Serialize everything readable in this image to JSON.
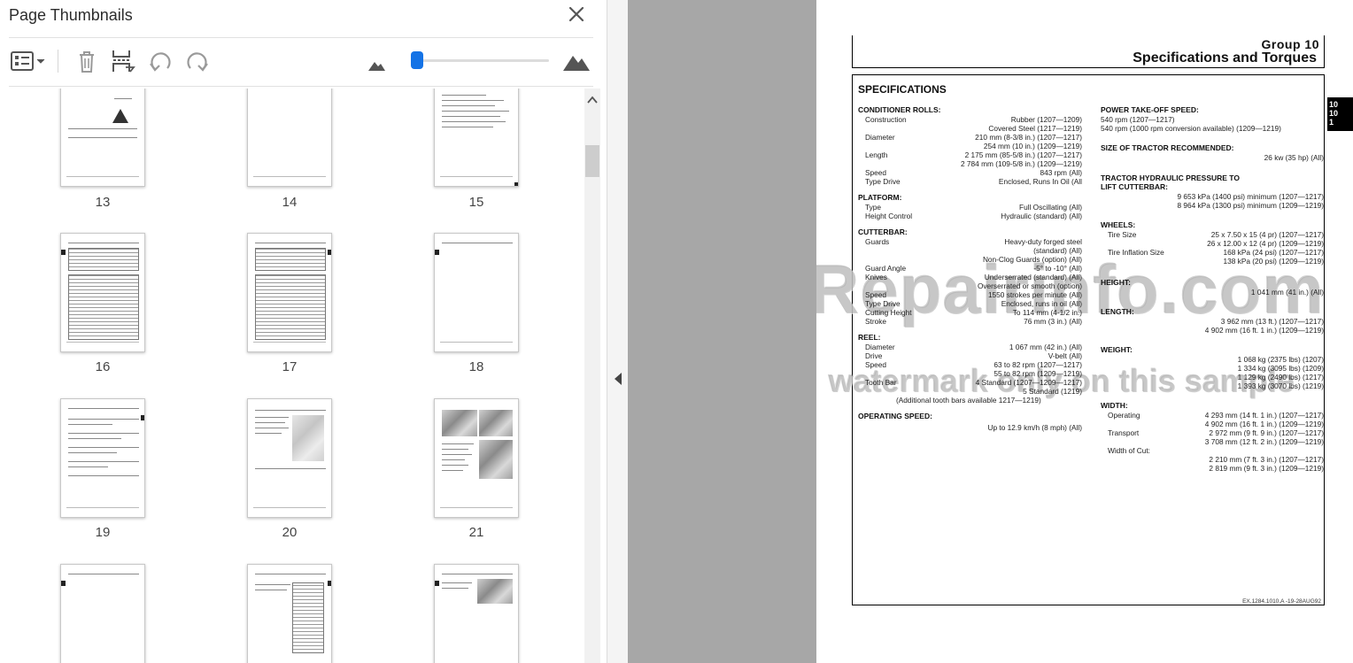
{
  "panel": {
    "title": "Page Thumbnails",
    "close_icon": "close-icon",
    "toolbar": {
      "options_icon": "thumbnail-options-icon",
      "delete_icon": "trash-icon",
      "insert_icon": "insert-pages-icon",
      "rotate_ccw_icon": "rotate-counterclockwise-icon",
      "rotate_cw_icon": "rotate-clockwise-icon",
      "zoom_out_icon": "small-mountain-icon",
      "zoom_in_icon": "large-mountain-icon",
      "zoom_level": 0.03
    },
    "thumbnails": [
      {
        "page": "13"
      },
      {
        "page": "14"
      },
      {
        "page": "15"
      },
      {
        "page": "16"
      },
      {
        "page": "17"
      },
      {
        "page": "18"
      },
      {
        "page": "19"
      },
      {
        "page": "20"
      },
      {
        "page": "21"
      },
      {
        "page": ""
      },
      {
        "page": ""
      },
      {
        "page": ""
      }
    ]
  },
  "document": {
    "group_label": "Group 10",
    "group_subtitle": "Specifications and Torques",
    "side_tab": [
      "10",
      "10",
      "1"
    ],
    "heading": "SPECIFICATIONS",
    "footer_code": "EX,1284,1010,A -19-28AUG92",
    "left_column": {
      "conditioner": {
        "title": "CONDITIONER ROLLS:",
        "rows": [
          {
            "label": "Construction",
            "value": "Rubber (1207—1209)"
          },
          {
            "label": "",
            "value": "Covered Steel (1217—1219)"
          },
          {
            "label": "Diameter",
            "value": "210 mm (8-3/8 in.) (1207—1217)"
          },
          {
            "label": "",
            "value": "254 mm (10 in.) (1209—1219)"
          },
          {
            "label": "Length",
            "value": "2 175 mm (85-5/8 in.) (1207—1217)"
          },
          {
            "label": "",
            "value": "2 784 mm (109-5/8 in.) (1209—1219)"
          },
          {
            "label": "Speed",
            "value": "843 rpm (All)"
          },
          {
            "label": "Type Drive",
            "value": "Enclosed, Runs In Oil (All"
          }
        ]
      },
      "platform": {
        "title": "PLATFORM:",
        "rows": [
          {
            "label": "Type",
            "value": "Full Oscillating (All)"
          },
          {
            "label": "Height Control",
            "value": "Hydraulic (standard) (All)"
          }
        ]
      },
      "cutterbar": {
        "title": "CUTTERBAR:",
        "rows": [
          {
            "label": "Guards",
            "value": "Heavy-duty forged steel"
          },
          {
            "label": "",
            "value": "(standard) (All)"
          },
          {
            "label": "",
            "value": "Non-Clog Guards (option) (All)"
          },
          {
            "label": "Guard Angle",
            "value": "-5° to -10° (All)"
          },
          {
            "label": "Knives",
            "value": "Underserrated (standard) (All)"
          },
          {
            "label": "",
            "value": "Overserrated or smooth (option)"
          },
          {
            "label": "Speed",
            "value": "1550 strokes per minute (All)"
          },
          {
            "label": "Type Drive",
            "value": "Enclosed, runs in oil (All)"
          },
          {
            "label": "Cutting Height",
            "value": "To 114 mm (4-1/2 in.)"
          },
          {
            "label": "Stroke",
            "value": "76 mm (3 in.) (All)"
          }
        ]
      },
      "reel": {
        "title": "REEL:",
        "rows": [
          {
            "label": "Diameter",
            "value": "1 067 mm (42 in.) (All)"
          },
          {
            "label": "Drive",
            "value": "V-belt (All)"
          },
          {
            "label": "Speed",
            "value": "63 to 82 rpm (1207—1217)"
          },
          {
            "label": "",
            "value": "55 to 82 rpm (1209—1219)"
          },
          {
            "label": "Tooth Bar",
            "value": "4 Standard (1207—1209—1217)"
          },
          {
            "label": "",
            "value": "5 Standard (1219)"
          }
        ],
        "note": "(Additional tooth bars available 1217—1219)"
      },
      "operating_speed": {
        "title": "OPERATING SPEED:",
        "value": "Up to 12.9 km/h (8 mph) (All)"
      }
    },
    "right_column": {
      "pto": {
        "title": "POWER TAKE-OFF SPEED:",
        "lines": [
          "540 rpm (1207—1217)",
          "540 rpm (1000 rpm conversion available) (1209—1219)"
        ]
      },
      "tractor_size": {
        "title": "SIZE OF TRACTOR RECOMMENDED:",
        "value": "26 kw (35 hp) (All)"
      },
      "hydraulic": {
        "title_1": "TRACTOR HYDRAULIC PRESSURE TO",
        "title_2": "LIFT CUTTERBAR:",
        "values": [
          "9 653 kPa (1400 psi) minimum (1207—1217)",
          "8 964 kPa (1300 psi) minimum (1209—1219)"
        ]
      },
      "wheels": {
        "title": "WHEELS:",
        "rows": [
          {
            "label": "Tire Size",
            "value": "25 x 7.50 x 15 (4 pr) (1207—1217)"
          },
          {
            "label": "",
            "value": "26 x 12.00 x 12 (4 pr) (1209—1219)"
          },
          {
            "label": "Tire Inflation Size",
            "value": "168 kPa (24 psi) (1207—1217)"
          },
          {
            "label": "",
            "value": "138 kPa (20 psi) (1209—1219)"
          }
        ]
      },
      "height": {
        "title": "HEIGHT:",
        "value": "1 041 mm (41 in.) (All)"
      },
      "length": {
        "title": "LENGTH:",
        "values": [
          "3 962 mm (13 ft.) (1207—1217)",
          "4 902 mm (16 ft. 1 in.) (1209—1219)"
        ]
      },
      "weight": {
        "title": "WEIGHT:",
        "values": [
          "1 068 kg (2375 lbs) (1207)",
          "1 334 kg (3095 lbs) (1209)",
          "1 129 kg (2490 lbs) (1217)",
          "1 393 kg (3070 lbs) (1219)"
        ]
      },
      "width": {
        "title": "WIDTH:",
        "operating_label": "Operating",
        "operating": [
          "4 293 mm (14 ft. 1 in.) (1207—1217)",
          "4 902 mm (16 ft. 1 in.) (1209—1219)"
        ],
        "transport_label": "Transport",
        "transport": [
          "2 972 mm (9 ft. 9 in.) (1207—1217)",
          "3 708 mm (12 ft. 2 in.) (1209—1219)"
        ],
        "cut_label": "Width of Cut:",
        "cut": [
          "2 210 mm (7 ft. 3 in.) (1207—1217)",
          "2 819 mm (9 ft. 3 in.) (1209—1219)"
        ]
      }
    },
    "watermark_main": "eRepairinfo.com",
    "watermark_sub": "watermark only on this sample"
  }
}
